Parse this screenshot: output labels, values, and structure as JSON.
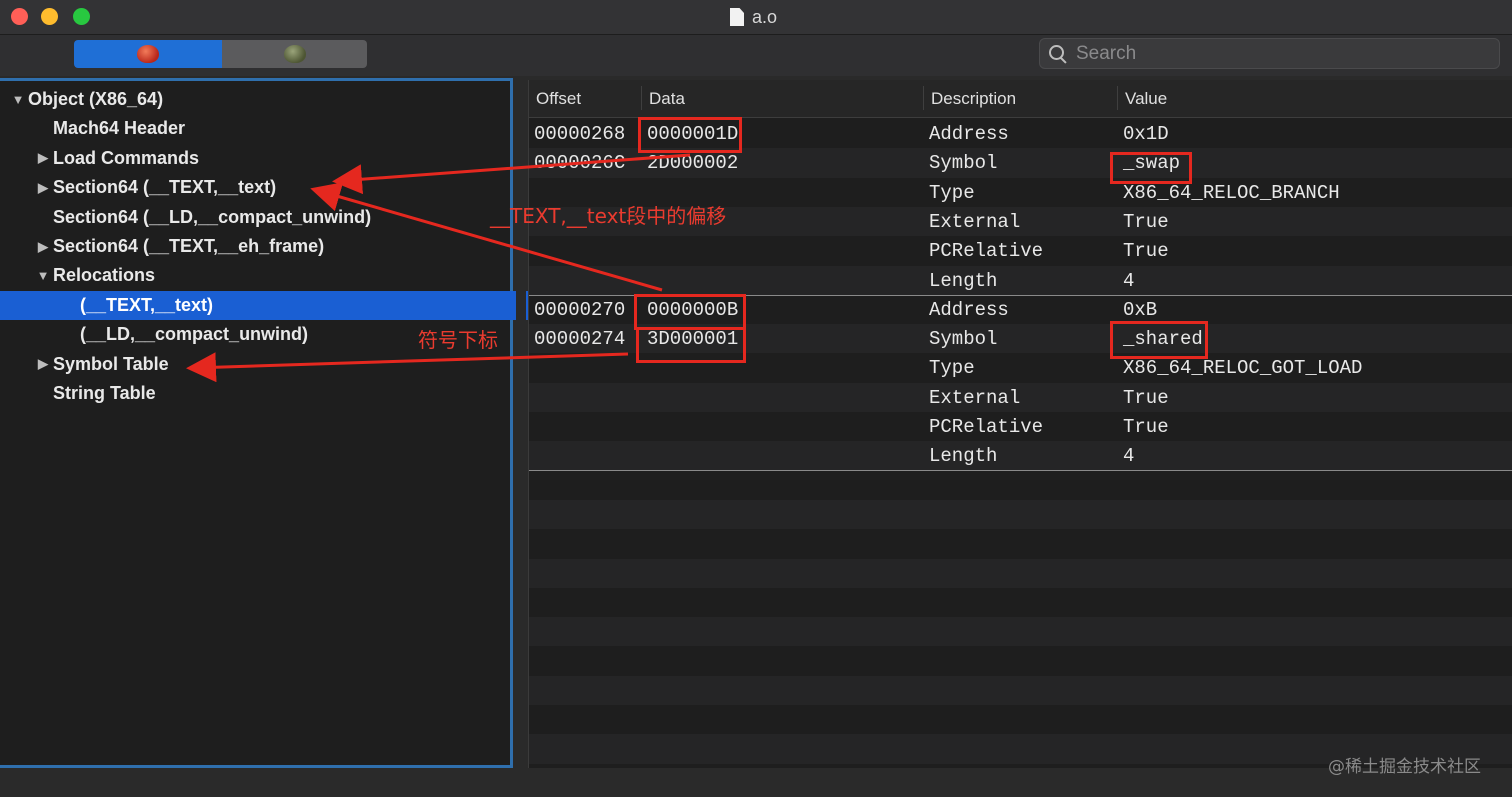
{
  "window": {
    "title": "a.o"
  },
  "search": {
    "placeholder": "Search"
  },
  "sidebar": {
    "items": [
      {
        "label": "Object  (X86_64)",
        "indent": 0,
        "expander": "down"
      },
      {
        "label": "Mach64 Header",
        "indent": 1,
        "expander": "none"
      },
      {
        "label": "Load Commands",
        "indent": 1,
        "expander": "right"
      },
      {
        "label": "Section64 (__TEXT,__text)",
        "indent": 1,
        "expander": "right"
      },
      {
        "label": "Section64 (__LD,__compact_unwind)",
        "indent": 1,
        "expander": "none"
      },
      {
        "label": "Section64 (__TEXT,__eh_frame)",
        "indent": 1,
        "expander": "right"
      },
      {
        "label": "Relocations",
        "indent": 1,
        "expander": "down"
      },
      {
        "label": "(__TEXT,__text)",
        "indent": 2,
        "expander": "none",
        "selected": true
      },
      {
        "label": "(__LD,__compact_unwind)",
        "indent": 2,
        "expander": "none"
      },
      {
        "label": "Symbol Table",
        "indent": 1,
        "expander": "right"
      },
      {
        "label": "String Table",
        "indent": 1,
        "expander": "none"
      }
    ]
  },
  "table": {
    "columns": [
      "Offset",
      "Data",
      "Description",
      "Value"
    ],
    "rows": [
      {
        "offset": "00000268",
        "data": "0000001D",
        "desc": "Address",
        "value": "0x1D"
      },
      {
        "offset": "0000026C",
        "data": "2D000002",
        "desc": "Symbol",
        "value": "_swap"
      },
      {
        "offset": "",
        "data": "",
        "desc": "Type",
        "value": "X86_64_RELOC_BRANCH"
      },
      {
        "offset": "",
        "data": "",
        "desc": "External",
        "value": "True"
      },
      {
        "offset": "",
        "data": "",
        "desc": "PCRelative",
        "value": "True"
      },
      {
        "offset": "",
        "data": "",
        "desc": "Length",
        "value": "4"
      },
      {
        "offset": "00000270",
        "data": "0000000B",
        "desc": "Address",
        "value": "0xB"
      },
      {
        "offset": "00000274",
        "data": "3D000001",
        "desc": "Symbol",
        "value": "_shared"
      },
      {
        "offset": "",
        "data": "",
        "desc": "Type",
        "value": "X86_64_RELOC_GOT_LOAD"
      },
      {
        "offset": "",
        "data": "",
        "desc": "External",
        "value": "True"
      },
      {
        "offset": "",
        "data": "",
        "desc": "PCRelative",
        "value": "True"
      },
      {
        "offset": "",
        "data": "",
        "desc": "Length",
        "value": "4"
      }
    ]
  },
  "annotations": {
    "text_offset": "__TEXT,__text段中的偏移",
    "symbol_index": "符号下标",
    "color": "#e5281f"
  },
  "watermark": "@稀土掘金技术社区"
}
